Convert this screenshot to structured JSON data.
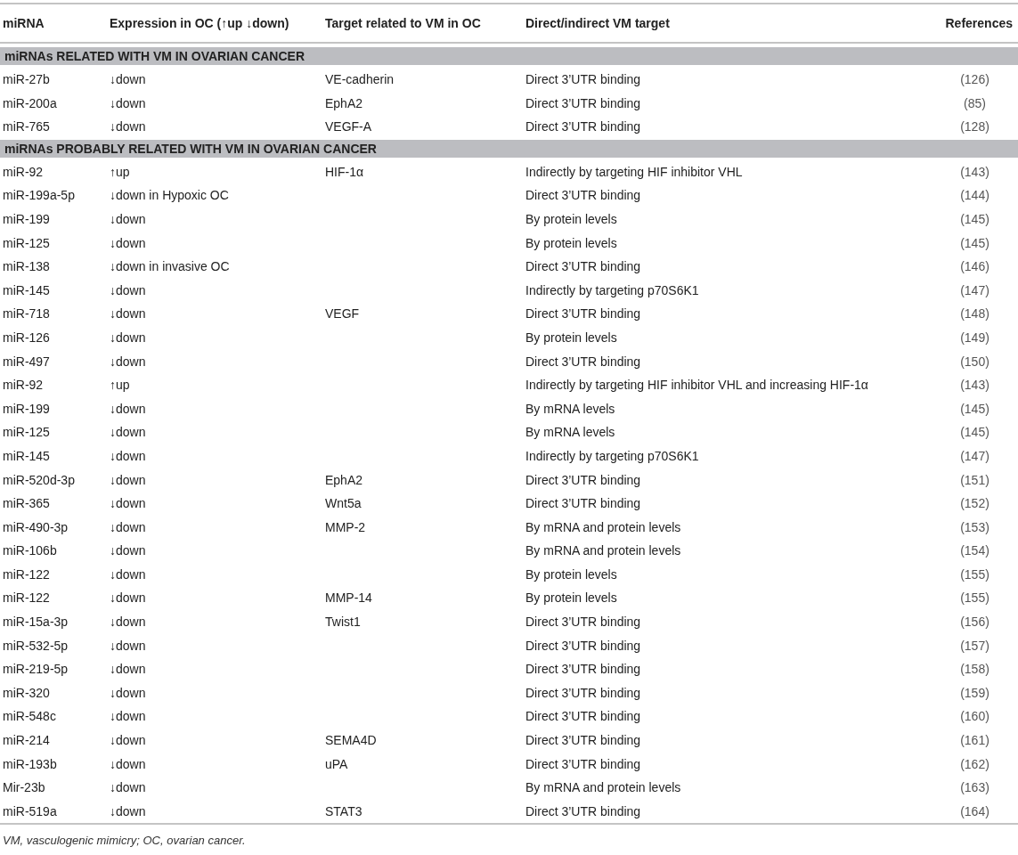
{
  "table": {
    "columns": [
      "miRNA",
      "Expression in OC (↑up ↓down)",
      "Target related to VM in OC",
      "Direct/indirect VM target",
      "References"
    ],
    "rows": [
      {
        "kind": "section",
        "title": "miRNAs RELATED WITH VM IN OVARIAN CANCER"
      },
      {
        "kind": "entry",
        "mirna": "miR-27b",
        "expression": "↓down",
        "target": "VE-cadherin",
        "mechanism": "Direct 3’UTR binding",
        "reference": "(126)"
      },
      {
        "kind": "entry",
        "mirna": "miR-200a",
        "expression": "↓down",
        "target": "EphA2",
        "mechanism": "Direct 3’UTR binding",
        "reference": "(85)"
      },
      {
        "kind": "entry",
        "mirna": "miR-765",
        "expression": "↓down",
        "target": "VEGF-A",
        "mechanism": "Direct 3’UTR binding",
        "reference": "(128)"
      },
      {
        "kind": "section",
        "title": "miRNAs PROBABLY RELATED WITH VM IN OVARIAN CANCER"
      },
      {
        "kind": "entry",
        "mirna": "miR-92",
        "expression": "↑up",
        "target": "HIF-1α",
        "mechanism": "Indirectly by targeting HIF inhibitor VHL",
        "reference": "(143)"
      },
      {
        "kind": "entry",
        "mirna": "miR-199a-5p",
        "expression": "↓down in Hypoxic OC",
        "mechanism": "Direct 3’UTR binding",
        "reference": "(144)"
      },
      {
        "kind": "entry",
        "mirna": "miR-199",
        "expression": "↓down",
        "mechanism": "By protein levels",
        "reference": "(145)"
      },
      {
        "kind": "entry",
        "mirna": "miR-125",
        "expression": "↓down",
        "mechanism": "By protein levels",
        "reference": "(145)"
      },
      {
        "kind": "entry",
        "mirna": "miR-138",
        "expression": "↓down in invasive OC",
        "mechanism": "Direct 3’UTR binding",
        "reference": "(146)"
      },
      {
        "kind": "entry",
        "mirna": "miR-145",
        "expression": "↓down",
        "mechanism": "Indirectly by targeting p70S6K1",
        "reference": "(147)"
      },
      {
        "kind": "entry",
        "mirna": "miR-718",
        "expression": "↓down",
        "target": "VEGF",
        "mechanism": "Direct 3’UTR binding",
        "reference": "(148)"
      },
      {
        "kind": "entry",
        "mirna": "miR-126",
        "expression": "↓down",
        "mechanism": "By protein levels",
        "reference": "(149)"
      },
      {
        "kind": "entry",
        "mirna": "miR-497",
        "expression": "↓down",
        "mechanism": "Direct 3’UTR binding",
        "reference": "(150)"
      },
      {
        "kind": "entry",
        "mirna": "miR-92",
        "expression": "↑up",
        "mechanism": "Indirectly by targeting HIF inhibitor VHL and increasing HIF-1α",
        "reference": "(143)"
      },
      {
        "kind": "entry",
        "mirna": "miR-199",
        "expression": "↓down",
        "mechanism": "By mRNA levels",
        "reference": "(145)"
      },
      {
        "kind": "entry",
        "mirna": "miR-125",
        "expression": "↓down",
        "mechanism": "By mRNA levels",
        "reference": "(145)"
      },
      {
        "kind": "entry",
        "mirna": "miR-145",
        "expression": "↓down",
        "mechanism": "Indirectly by targeting p70S6K1",
        "reference": "(147)"
      },
      {
        "kind": "entry",
        "mirna": "miR-520d-3p",
        "expression": "↓down",
        "target": "EphA2",
        "mechanism": "Direct 3’UTR binding",
        "reference": "(151)"
      },
      {
        "kind": "entry",
        "mirna": "miR-365",
        "expression": "↓down",
        "target": "Wnt5a",
        "mechanism": "Direct 3’UTR binding",
        "reference": "(152)"
      },
      {
        "kind": "entry",
        "mirna": "miR-490-3p",
        "expression": "↓down",
        "target": "MMP-2",
        "mechanism": "By mRNA and protein levels",
        "reference": "(153)"
      },
      {
        "kind": "entry",
        "mirna": "miR-106b",
        "expression": "↓down",
        "mechanism": "By mRNA and protein levels",
        "reference": "(154)"
      },
      {
        "kind": "entry",
        "mirna": "miR-122",
        "expression": "↓down",
        "mechanism": "By protein levels",
        "reference": "(155)"
      },
      {
        "kind": "entry",
        "mirna": "miR-122",
        "expression": "↓down",
        "target": "MMP-14",
        "mechanism": "By protein levels",
        "reference": "(155)"
      },
      {
        "kind": "entry",
        "mirna": "miR-15a-3p",
        "expression": "↓down",
        "target": "Twist1",
        "mechanism": "Direct 3’UTR binding",
        "reference": "(156)"
      },
      {
        "kind": "entry",
        "mirna": "miR-532-5p",
        "expression": "↓down",
        "mechanism": "Direct 3’UTR binding",
        "reference": "(157)"
      },
      {
        "kind": "entry",
        "mirna": "miR-219-5p",
        "expression": "↓down",
        "mechanism": "Direct 3’UTR binding",
        "reference": "(158)"
      },
      {
        "kind": "entry",
        "mirna": "miR-320",
        "expression": "↓down",
        "mechanism": "Direct 3’UTR binding",
        "reference": "(159)"
      },
      {
        "kind": "entry",
        "mirna": "miR-548c",
        "expression": "↓down",
        "mechanism": "Direct 3’UTR binding",
        "reference": "(160)"
      },
      {
        "kind": "entry",
        "mirna": "miR-214",
        "expression": "↓down",
        "target": "SEMA4D",
        "mechanism": "Direct 3’UTR binding",
        "reference": "(161)"
      },
      {
        "kind": "entry",
        "mirna": "miR-193b",
        "expression": "↓down",
        "target": "uPA",
        "mechanism": "Direct 3’UTR binding",
        "reference": "(162)"
      },
      {
        "kind": "entry",
        "mirna": "Mir-23b",
        "expression": "↓down",
        "mechanism": "By mRNA and protein levels",
        "reference": "(163)"
      },
      {
        "kind": "entry",
        "mirna": "miR-519a",
        "expression": "↓down",
        "target": "STAT3",
        "mechanism": "Direct 3’UTR binding",
        "reference": "(164)"
      }
    ]
  },
  "footnote": "VM, vasculogenic mimicry; OC, ovarian cancer."
}
